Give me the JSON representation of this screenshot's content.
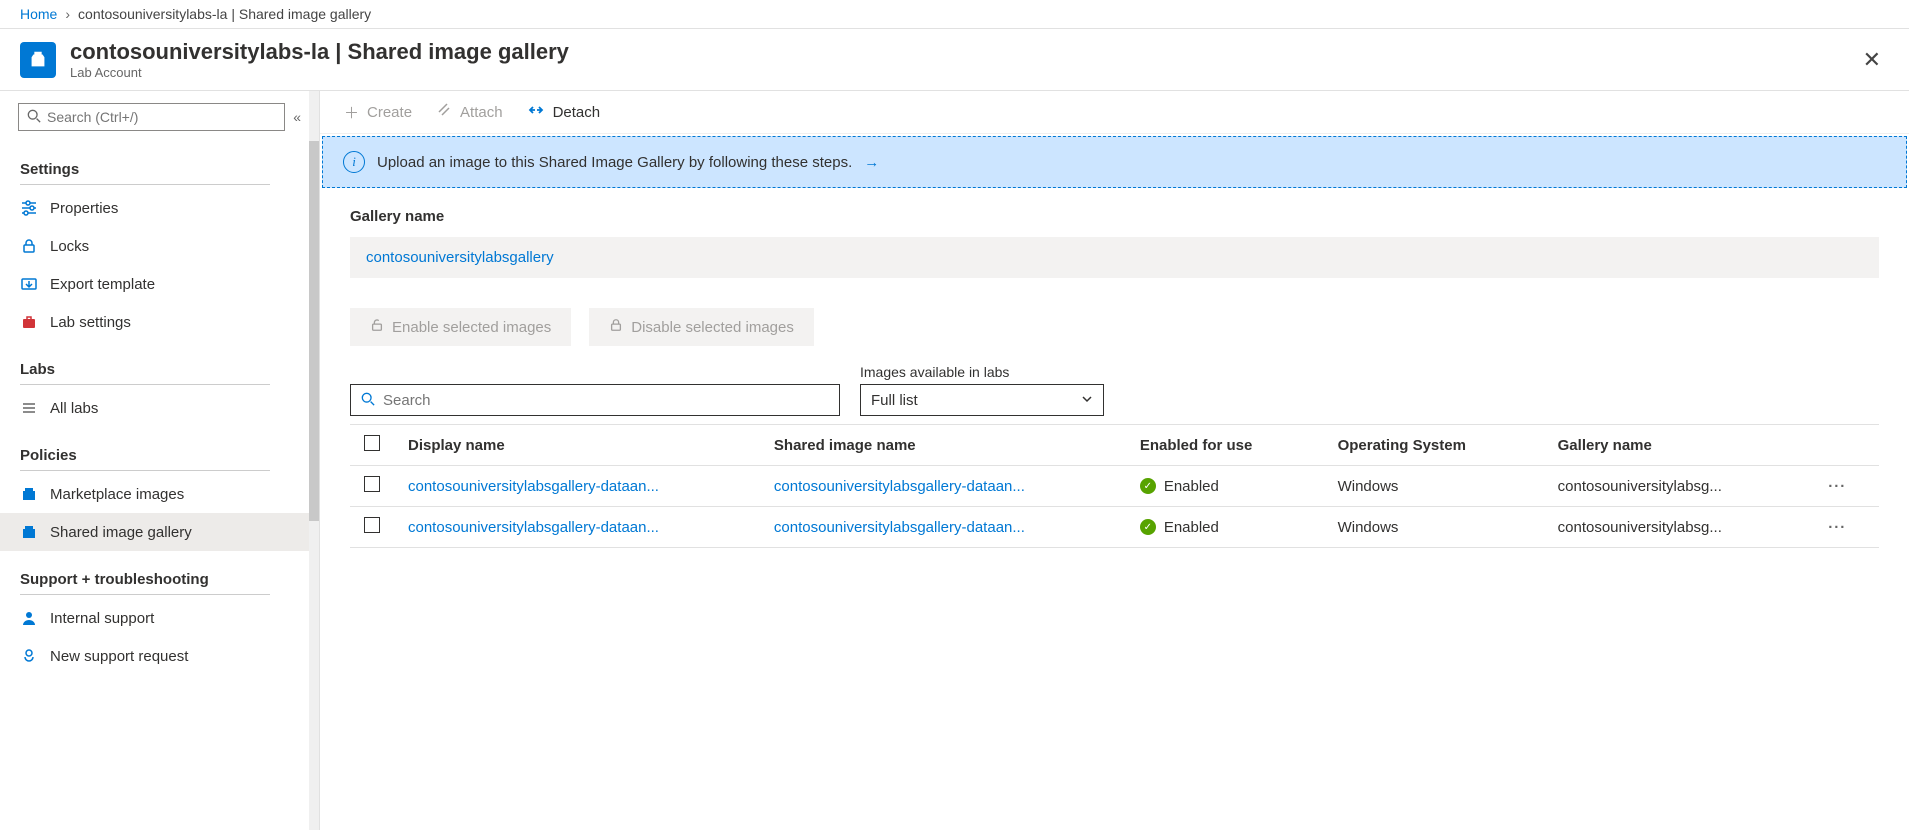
{
  "breadcrumb": {
    "home": "Home",
    "current": "contosouniversitylabs-la | Shared image gallery"
  },
  "header": {
    "title": "contosouniversitylabs-la | Shared image gallery",
    "subtitle": "Lab Account"
  },
  "sidebar": {
    "search_placeholder": "Search (Ctrl+/)",
    "sections": {
      "settings": "Settings",
      "labs": "Labs",
      "policies": "Policies",
      "support": "Support + troubleshooting"
    },
    "items": {
      "properties": "Properties",
      "locks": "Locks",
      "export_template": "Export template",
      "lab_settings": "Lab settings",
      "all_labs": "All labs",
      "marketplace_images": "Marketplace images",
      "shared_image_gallery": "Shared image gallery",
      "internal_support": "Internal support",
      "new_support_request": "New support request"
    }
  },
  "toolbar": {
    "create": "Create",
    "attach": "Attach",
    "detach": "Detach"
  },
  "banner": {
    "text": "Upload an image to this Shared Image Gallery by following these steps."
  },
  "gallery": {
    "label": "Gallery name",
    "name": "contosouniversitylabsgallery"
  },
  "buttons": {
    "enable": "Enable selected images",
    "disable": "Disable selected images"
  },
  "filters": {
    "search_placeholder": "Search",
    "dropdown_label": "Images available in labs",
    "dropdown_value": "Full list"
  },
  "table": {
    "cols": {
      "display_name": "Display name",
      "shared_name": "Shared image name",
      "enabled": "Enabled for use",
      "os": "Operating System",
      "gallery": "Gallery name"
    },
    "rows": [
      {
        "display_name": "contosouniversitylabsgallery-dataan...",
        "shared_name": "contosouniversitylabsgallery-dataan...",
        "enabled": "Enabled",
        "os": "Windows",
        "gallery": "contosouniversitylabsg..."
      },
      {
        "display_name": "contosouniversitylabsgallery-dataan...",
        "shared_name": "contosouniversitylabsgallery-dataan...",
        "enabled": "Enabled",
        "os": "Windows",
        "gallery": "contosouniversitylabsg..."
      }
    ]
  }
}
